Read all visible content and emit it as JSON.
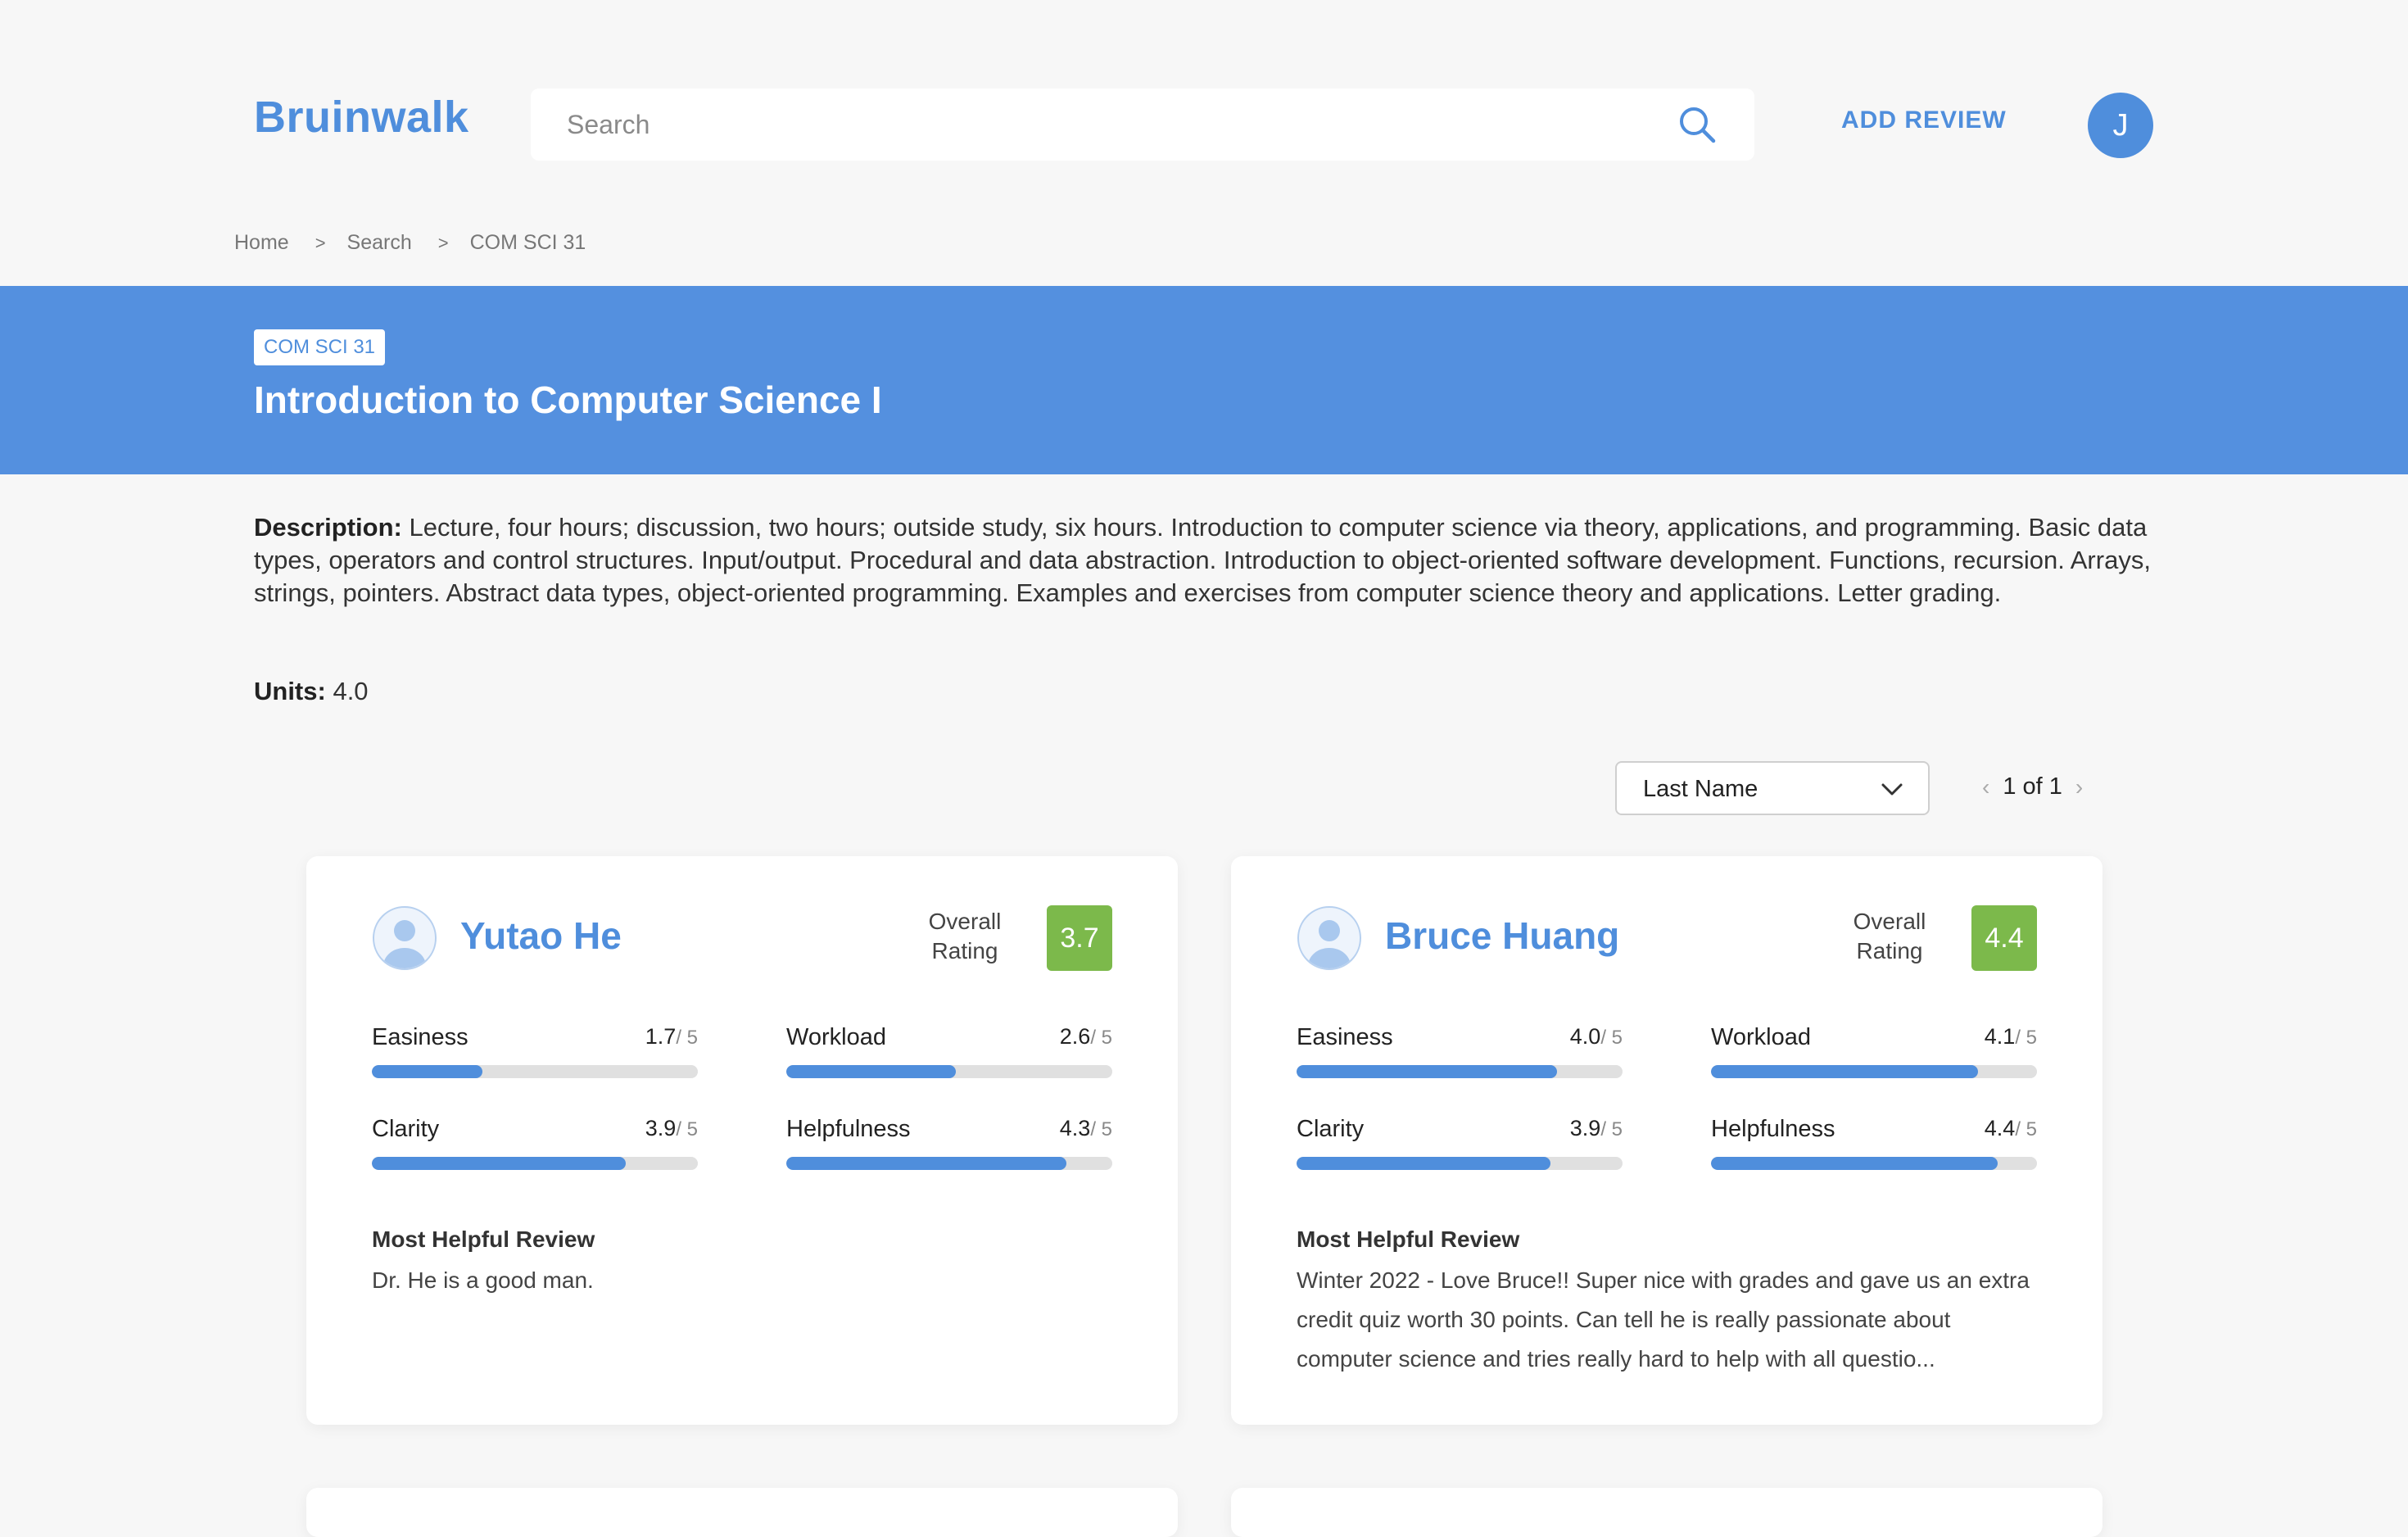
{
  "header": {
    "logo": "Bruinwalk",
    "search_placeholder": "Search",
    "add_review": "ADD REVIEW",
    "avatar_initial": "J"
  },
  "breadcrumb": {
    "items": [
      "Home",
      "Search",
      "COM SCI 31"
    ],
    "separator": ">"
  },
  "course": {
    "code": "COM SCI 31",
    "title": "Introduction to Computer Science I",
    "description_label": "Description:",
    "description": "Lecture, four hours; discussion, two hours; outside study, six hours. Introduction to computer science via theory, applications, and programming. Basic data types, operators and control structures. Input/output. Procedural and data abstraction. Introduction to object-oriented software development. Functions, recursion. Arrays, strings, pointers. Abstract data types, object-oriented programming. Examples and exercises from computer science theory and applications. Letter grading.",
    "units_label": "Units:",
    "units": "4.0"
  },
  "controls": {
    "sort_selected": "Last Name",
    "pager_text": "1 of 1",
    "pager_prev": "‹",
    "pager_next": "›"
  },
  "colors": {
    "brand": "#4f8edc",
    "banner": "#5490df",
    "rating_badge": "#7cb94b"
  },
  "professors": [
    {
      "name": "Yutao He",
      "overall_label_1": "Overall",
      "overall_label_2": "Rating",
      "overall": "3.7",
      "metrics": [
        {
          "name": "Easiness",
          "value": "1.7",
          "max": "/ 5",
          "fraction": 0.34
        },
        {
          "name": "Workload",
          "value": "2.6",
          "max": "/ 5",
          "fraction": 0.52
        },
        {
          "name": "Clarity",
          "value": "3.9",
          "max": "/ 5",
          "fraction": 0.78
        },
        {
          "name": "Helpfulness",
          "value": "4.3",
          "max": "/ 5",
          "fraction": 0.86
        }
      ],
      "helpful_title": "Most Helpful Review",
      "helpful_review": "Dr. He is a good man."
    },
    {
      "name": "Bruce Huang",
      "overall_label_1": "Overall",
      "overall_label_2": "Rating",
      "overall": "4.4",
      "metrics": [
        {
          "name": "Easiness",
          "value": "4.0",
          "max": "/ 5",
          "fraction": 0.8
        },
        {
          "name": "Workload",
          "value": "4.1",
          "max": "/ 5",
          "fraction": 0.82
        },
        {
          "name": "Clarity",
          "value": "3.9",
          "max": "/ 5",
          "fraction": 0.78
        },
        {
          "name": "Helpfulness",
          "value": "4.4",
          "max": "/ 5",
          "fraction": 0.88
        }
      ],
      "helpful_title": "Most Helpful Review",
      "helpful_review": "Winter 2022 - Love Bruce!! Super nice with grades and gave us an extra credit quiz worth 30 points. Can tell he is really passionate about computer science and tries really hard to help with all questio..."
    }
  ]
}
